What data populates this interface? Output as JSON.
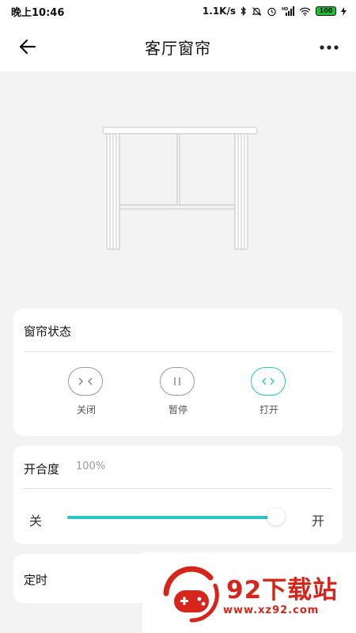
{
  "status_bar": {
    "time": "晚上10:46",
    "net_speed": "1.1K/s",
    "battery": "100"
  },
  "header": {
    "title": "客厅窗帘"
  },
  "curtain_status": {
    "title": "窗帘状态",
    "controls": [
      {
        "label": "关闭",
        "icon": "close-curtain-icon",
        "active": false
      },
      {
        "label": "暂停",
        "icon": "pause-icon",
        "active": false
      },
      {
        "label": "打开",
        "icon": "open-curtain-icon",
        "active": true
      }
    ]
  },
  "opening": {
    "title": "开合度",
    "percent": "100%",
    "value": 1.0,
    "min_label": "关",
    "max_label": "开"
  },
  "timer": {
    "title": "定时"
  },
  "watermark": {
    "brand": "92下载站",
    "url": "www.xz92.com"
  },
  "colors": {
    "accent": "#29c6c6",
    "watermark": "#d6261c"
  }
}
